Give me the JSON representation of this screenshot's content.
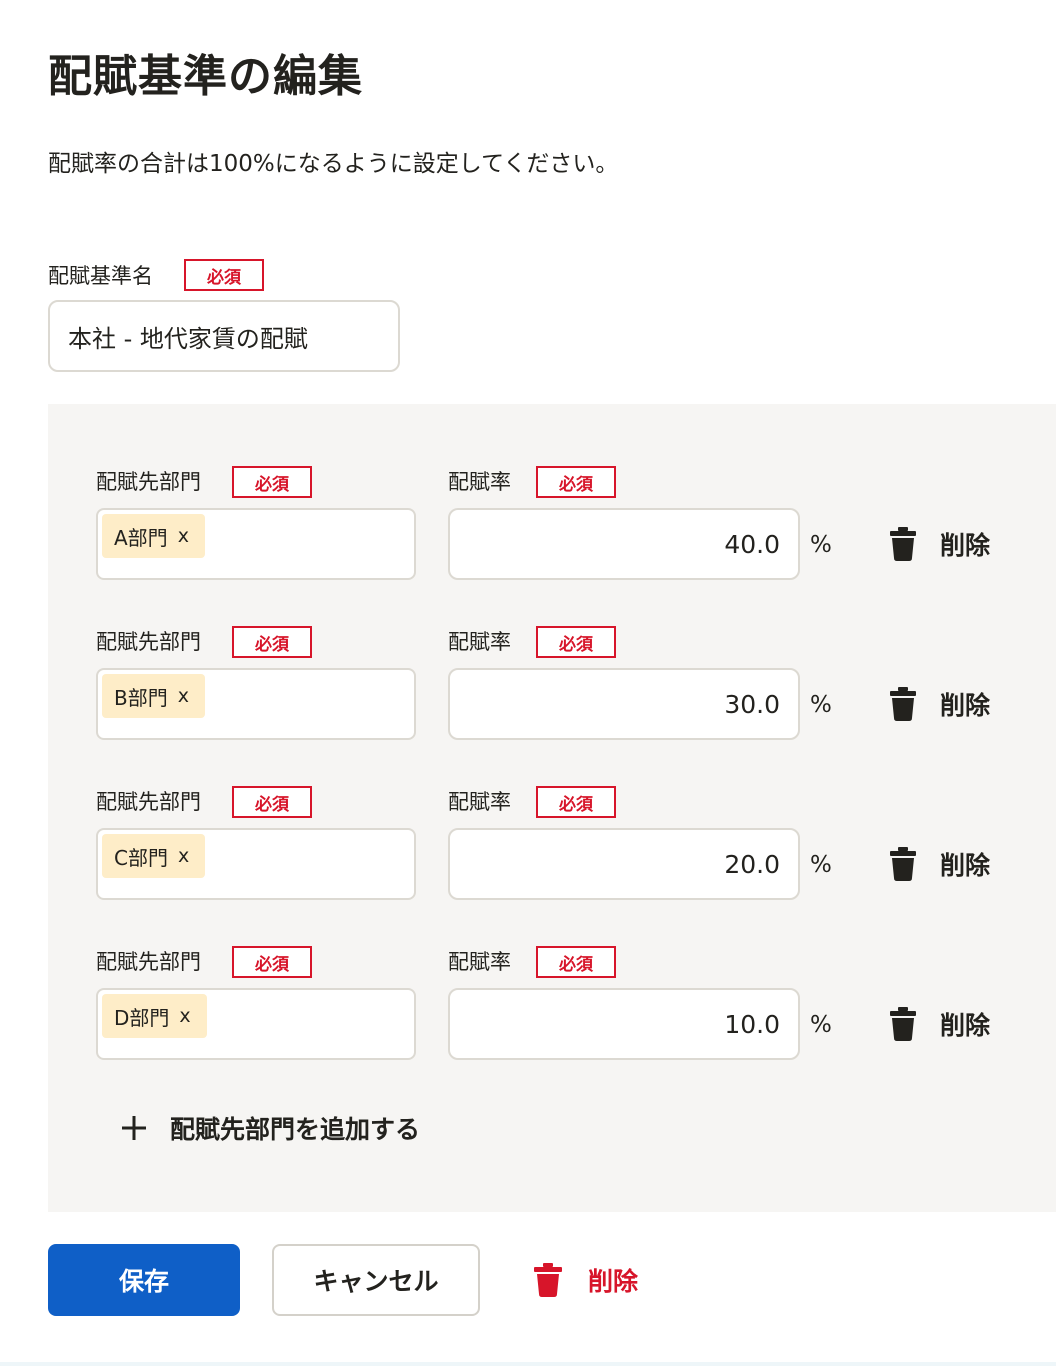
{
  "page": {
    "title": "配賦基準の編集",
    "description": "配賦率の合計は100%になるように設定してください。"
  },
  "name_field": {
    "label": "配賦基準名",
    "required": "必須",
    "value": "本社 - 地代家賃の配賦"
  },
  "rows_labels": {
    "dept_label": "配賦先部門",
    "rate_label": "配賦率",
    "required": "必須",
    "unit": "%",
    "delete_label": "削除",
    "chip_remove": "x"
  },
  "rows": [
    {
      "dept": "A部門",
      "rate": "40.0"
    },
    {
      "dept": "B部門",
      "rate": "30.0"
    },
    {
      "dept": "C部門",
      "rate": "20.0"
    },
    {
      "dept": "D部門",
      "rate": "10.0"
    }
  ],
  "add_link": {
    "label": "配賦先部門を追加する"
  },
  "footer": {
    "save_label": "保存",
    "cancel_label": "キャンセル",
    "delete_label": "削除"
  },
  "colors": {
    "primary": "#0f5fc7",
    "danger": "#d7152a",
    "chip_bg": "#feedc8",
    "panel_bg": "#f6f5f3"
  }
}
